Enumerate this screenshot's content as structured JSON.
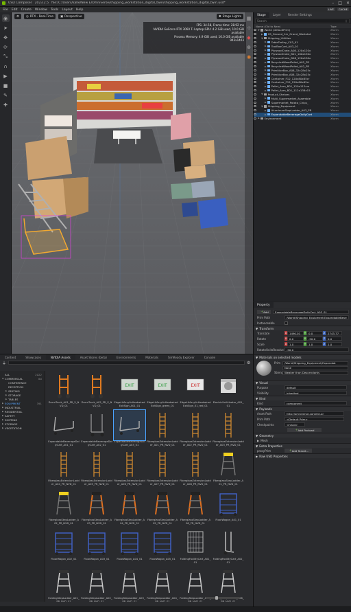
{
  "app": {
    "name": "USD Composer",
    "version": "2023.2.5",
    "title_path": "file:/C:/Users/kalle/New E/Omniverse/shipping_workstation_digital_twin/shipping_workstation_digital_twin.usd*"
  },
  "menu": [
    "File",
    "Edit",
    "Create",
    "Window",
    "Tools",
    "Layout",
    "Help"
  ],
  "menu_right": {
    "live": "LIVE",
    "cache": "CACHE"
  },
  "viewport": {
    "renderer": "RTX - Real-Time",
    "camera": "Perspective",
    "lights": "Stage Lights"
  },
  "stats": [
    "FPS: 34.58, Frame time: 28.92 ms",
    "NVIDIA GeForce RTX 3060 Ti Laptop GPU: 4.2 GiB used, 10.0 GiB available",
    "Process Memory: 4.9 GiB used, 16.0 GiB available",
    "943x1403"
  ],
  "stage": {
    "tabs": [
      "Stage",
      "Layer",
      "Render Settings"
    ],
    "active_tab": "Stage",
    "search_placeholder": "Search",
    "col_name": "Name (Old to New)",
    "col_type": "Type",
    "rows": [
      {
        "name": "World (defaultPrim)",
        "type": "Xform",
        "d": 0,
        "tri": "▼",
        "c": "#a0a0a0"
      },
      {
        "name": "CS_Ground_1m_Grand_Workstat",
        "type": "Xform",
        "d": 1,
        "tri": "▶",
        "c": "#6fb3ff"
      },
      {
        "name": "Shipping_Utilities",
        "type": "Xform",
        "d": 1,
        "tri": "▼",
        "c": "#a0a0a0"
      },
      {
        "name": "TableTrolley_C03_01",
        "type": "Xform",
        "d": 2,
        "tri": "▶",
        "c": "#6fb3ff"
      },
      {
        "name": "ToolBoxCart_A03_01",
        "type": "Xform",
        "d": 2,
        "tri": "▶",
        "c": "#6fb3ff"
      },
      {
        "name": "PlywoodCrate_A08_120x120x",
        "type": "Xform",
        "d": 2,
        "tri": "▶",
        "c": "#6fb3ff"
      },
      {
        "name": "PlywoodCrate_B01_180x150x",
        "type": "Xform",
        "d": 2,
        "tri": "▶",
        "c": "#6fb3ff"
      },
      {
        "name": "PlywoodCrate_B08_120x150x",
        "type": "Xform",
        "d": 2,
        "tri": "▶",
        "c": "#6fb3ff"
      },
      {
        "name": "RecycledWoodPallet_A02_PR",
        "type": "Xform",
        "d": 2,
        "tri": "▶",
        "c": "#6fb3ff"
      },
      {
        "name": "RecycledWoodPallet_A02_PR",
        "type": "Xform",
        "d": 2,
        "tri": "▶",
        "c": "#6fb3ff"
      },
      {
        "name": "PrimitiveBox_A08_32x28x25c",
        "type": "Xform",
        "d": 2,
        "tri": "▶",
        "c": "#6fb3ff"
      },
      {
        "name": "PrimitiveBox_A08_32x28x25c",
        "type": "Xform",
        "d": 2,
        "tri": "▶",
        "c": "#6fb3ff"
      },
      {
        "name": "Container_F12_120x80x85cr",
        "type": "Xform",
        "d": 2,
        "tri": "▶",
        "c": "#6fb3ff"
      },
      {
        "name": "Container_F12_120x80x85cr",
        "type": "Xform",
        "d": 2,
        "tri": "▶",
        "c": "#6fb3ff"
      },
      {
        "name": "Pallet_Asm_B01_120x112cm",
        "type": "Xform",
        "d": 2,
        "tri": "▶",
        "c": "#6fb3ff"
      },
      {
        "name": "Pallet_Asm_B01_112x138x15",
        "type": "Xform",
        "d": 2,
        "tri": "▶",
        "c": "#6fb3ff"
      },
      {
        "name": "Product_Shelves",
        "type": "Xform",
        "d": 1,
        "tri": "▼",
        "c": "#a0a0a0"
      },
      {
        "name": "Multi_Supermarket_Assemble",
        "type": "Xform",
        "d": 2,
        "tri": "▶",
        "c": "#6fb3ff"
      },
      {
        "name": "Supermarket_Potato_Chips_",
        "type": "Xform",
        "d": 2,
        "tri": "▶",
        "c": "#6fb3ff"
      },
      {
        "name": "Shipping_Equipment",
        "type": "Xform",
        "d": 1,
        "tri": "▼",
        "c": "#a0a0a0"
      },
      {
        "name": "AluminumStepLadder_A03_PR",
        "type": "Xform",
        "d": 2,
        "tri": "▶",
        "c": "#6fb3ff"
      },
      {
        "name": "ExpandableBeverageDollyCart",
        "type": "Xform",
        "d": 2,
        "tri": "▶",
        "c": "#6fb3ff",
        "sel": true
      },
      {
        "name": "Environment",
        "type": "Xform",
        "d": 0,
        "tri": "▶",
        "c": "#a0a0a0"
      }
    ]
  },
  "property": {
    "title": "Property",
    "add_label": "Add",
    "name_value": "ExpandableBeverageDollyCart_A03_01",
    "prim_path_label": "Prim Path",
    "prim_path_value": "/World/Shipping_Equipment/ExpandableBeve",
    "instanceable_label": "Instanceable",
    "transform_title": "Transform",
    "translate_label": "Translate",
    "translate": [
      "1490.01",
      "0.0",
      "2743.77"
    ],
    "rotate_label": "Rotate",
    "rotate": [
      "0.0",
      "-90.0",
      "0.0"
    ],
    "scale_label": "Scale",
    "scale": [
      "1.0",
      "1.0",
      "1.0"
    ],
    "rotate_order_label": "RotateUnitsResolve",
    "rotate_order_value": "-90.0",
    "materials_title": "Materials on selected models",
    "material_prim_label": "Prim",
    "material_prim_value": "/World/Shipping_Equipment/Expandab",
    "material_none": "None",
    "material_strength_label": "Strength",
    "material_strength_value": "Weaker than Descendants",
    "visual_title": "Visual",
    "purpose_label": "Purpose",
    "purpose_value": "default",
    "visibility_label": "Visibility",
    "visibility_value": "inherited",
    "kind_title": "Kind",
    "kind_label": "Kind",
    "kind_value": "component",
    "payloads_title": "Payloads",
    "asset_path_label": "Asset Path",
    "asset_path_value": "http://omniverse-content-pr",
    "payload_prim_label": "Prim Path",
    "payload_prim_value": "<Default Prim>",
    "checkpoints_label": "Checkpoints",
    "checkpoints_value": "<head>",
    "add_payload": "Add Payload",
    "geometry_title": "Geometry",
    "mesh_label": "Mesh",
    "extra_title": "Extra Properties",
    "proxy_label": "proxyPrim",
    "add_target": "Add Target...",
    "raw_title": "Raw USD Properties"
  },
  "browser": {
    "tabs": [
      "Content",
      "Showcases",
      "NVIDIA Assets",
      "Asset Stores (beta)",
      "Environments",
      "Materials",
      "SimReady Explorer",
      "Console"
    ],
    "active_tab": "NVIDIA Assets",
    "categories": [
      {
        "label": "ALL",
        "count": "2022",
        "d": 0
      },
      {
        "label": "COMMERCIAL",
        "count": "60",
        "d": 0,
        "tri": "▼"
      },
      {
        "label": "CONFERENCE",
        "count": "",
        "d": 1
      },
      {
        "label": "RECEPTION",
        "count": "",
        "d": 1
      },
      {
        "label": "SEATING",
        "count": "",
        "d": 1,
        "tri": "▶"
      },
      {
        "label": "STORAGE",
        "count": "",
        "d": 1,
        "tri": "▶"
      },
      {
        "label": "TABLES",
        "count": "",
        "d": 1,
        "tri": "▶"
      },
      {
        "label": "EQUIPMENT",
        "count": "391",
        "d": 0,
        "tri": "▶",
        "active": true
      },
      {
        "label": "INDUSTRIAL",
        "count": "",
        "d": 0,
        "tri": "▶"
      },
      {
        "label": "RESIDENTIAL",
        "count": "",
        "d": 0,
        "tri": "▶"
      },
      {
        "label": "SAFETY",
        "count": "",
        "d": 0,
        "tri": "▶"
      },
      {
        "label": "SHIPPING",
        "count": "",
        "d": 0,
        "tri": "▶"
      },
      {
        "label": "STORAGE",
        "count": "",
        "d": 0,
        "tri": "▶"
      },
      {
        "label": "VEGETATION",
        "count": "",
        "d": 0,
        "tri": "▶"
      }
    ],
    "assets": [
      {
        "label": "DrumTruck_A01_PR_V_NVD_01",
        "kind": "handtruck"
      },
      {
        "label": "DrumTruck_A02_PR_V_NVD_01",
        "kind": "handtruck"
      },
      {
        "label": "EdgeLitAcrylicHardwiredExitSign_A01_01",
        "kind": "exitgreen"
      },
      {
        "label": "EdgeLitAcrylicHardwiredExitSign_green_01",
        "kind": "exitgreen"
      },
      {
        "label": "EdgeLitAcrylicHardwiredExitSign_01_red_01",
        "kind": "exitred"
      },
      {
        "label": "ElectricUnitHeater_A01_01",
        "kind": "heater"
      },
      {
        "label": "ExpandableBeverageDollyCart_A01_01",
        "kind": "cart"
      },
      {
        "label": "ExpandableBeverageDollyCart_A02_01",
        "kind": "cart2"
      },
      {
        "label": "ExpandableBeverageDollyCart_A03_01",
        "kind": "cart",
        "sel": true
      },
      {
        "label": "FiberglassExtensionLadder_A01_PR_NVD_01",
        "kind": "ladder"
      },
      {
        "label": "FiberglassExtensionLadder_A02_PR_NVD_01",
        "kind": "ladder"
      },
      {
        "label": "FiberglassExtensionLadder_A03_PR_NVD_01",
        "kind": "ladder"
      },
      {
        "label": "FiberglassExtensionLadder_A04_PR_NVD_01",
        "kind": "ladder"
      },
      {
        "label": "FiberglassExtensionLadder_A05_PR_NVD_01",
        "kind": "ladder"
      },
      {
        "label": "FiberglassExtensionLadder_A06_PR_NVD_01",
        "kind": "ladder"
      },
      {
        "label": "FiberglassExtensionLadder_A07_PR_NVD_01",
        "kind": "ladder"
      },
      {
        "label": "FiberglassExtensionLadder_A08_PR_NVD_01",
        "kind": "ladder"
      },
      {
        "label": "FiberglassStepLadder_A01_PR_NVD_01",
        "kind": "stepyellow"
      },
      {
        "label": "FiberglassStepLadder_A02_PR_NVD_01",
        "kind": "stepyellow"
      },
      {
        "label": "FiberglassStepLadder_A03_PR_NVD_01",
        "kind": "steporange"
      },
      {
        "label": "FiberglassStepLadder_A04_PR_NVD_01",
        "kind": "steporange"
      },
      {
        "label": "FiberglassStepLadder_A05_PR_NVD_01",
        "kind": "steporange"
      },
      {
        "label": "FiberglassStepLadder_A06_PR_NVD_01",
        "kind": "steporange"
      },
      {
        "label": "FloorWagon_A01_01",
        "kind": "wagon"
      },
      {
        "label": "FloorWagon_A02_01",
        "kind": "wagon"
      },
      {
        "label": "FloorWagon_A03_01",
        "kind": "wagon"
      },
      {
        "label": "FloorWagon_A04_01",
        "kind": "wagon"
      },
      {
        "label": "FloorWagon_A05_01",
        "kind": "wagon"
      },
      {
        "label": "FoldingFacilityCart_A01_01",
        "kind": "cage"
      },
      {
        "label": "FoldingFacilityCart_A02_01",
        "kind": "handtruck2"
      },
      {
        "label": "FoldingStepLadder_A01_PR_NVD_01",
        "kind": "folding"
      },
      {
        "label": "FoldingStepLadder_A02_PR_NVD_01",
        "kind": "folding"
      },
      {
        "label": "FoldingStepLadder_A03_PR_NVD_01",
        "kind": "folding"
      },
      {
        "label": "FoldingStepLadder_A04_PR_NVD_01",
        "kind": "folding"
      },
      {
        "label": "FoldingStepLadder_A05_PR_NVD_01",
        "kind": "folding"
      },
      {
        "label": "FoldingStepLadder_A06_PR_NVD_01",
        "kind": "folding"
      }
    ]
  }
}
